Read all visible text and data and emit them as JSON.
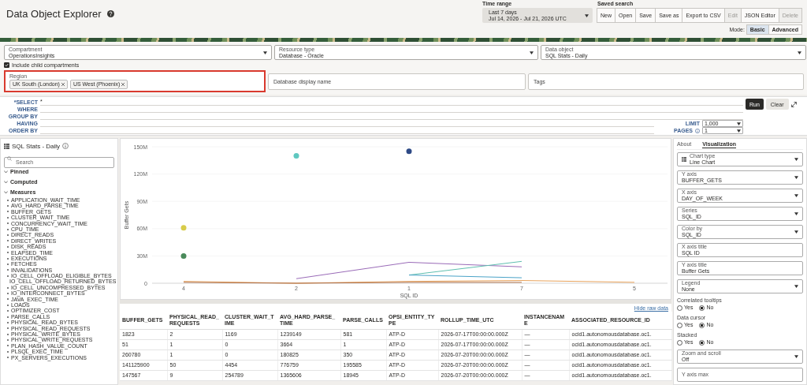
{
  "page": {
    "title": "Data Object Explorer"
  },
  "time_range": {
    "label": "Time range",
    "value": "Last 7 days",
    "subtext": "Jul 14, 2026 - Jul 21, 2026 UTC"
  },
  "saved_search": {
    "label": "Saved search",
    "buttons": [
      {
        "label": "New",
        "disabled": false
      },
      {
        "label": "Open",
        "disabled": false
      },
      {
        "label": "Save",
        "disabled": false
      },
      {
        "label": "Save as",
        "disabled": false
      },
      {
        "label": "Export to CSV",
        "disabled": false
      },
      {
        "label": "Edit",
        "disabled": true
      },
      {
        "label": "JSON Editor",
        "disabled": false
      },
      {
        "label": "Delete",
        "disabled": true
      }
    ]
  },
  "mode": {
    "label": "Mode:",
    "options": [
      {
        "label": "Basic",
        "selected": true
      },
      {
        "label": "Advanced",
        "selected": false
      }
    ]
  },
  "filters": {
    "selects": [
      {
        "label": "Compartment",
        "value": "OperationsInsights"
      },
      {
        "label": "Resource type",
        "value": "Database - Oracle"
      },
      {
        "label": "Data object",
        "value": "SQL Stats - Daily"
      }
    ],
    "include_child": {
      "label": "Include child compartments",
      "checked": true
    },
    "region": {
      "label": "Region",
      "highlighted": true,
      "chips": [
        "UK South (London)",
        "US West (Phoenix)"
      ]
    },
    "fields": [
      {
        "label": "Database display name"
      },
      {
        "label": "Tags"
      }
    ]
  },
  "query": {
    "clauses": [
      {
        "label": "*SELECT",
        "value": "*"
      },
      {
        "label": "WHERE"
      },
      {
        "label": "GROUP BY"
      },
      {
        "label": "HAVING"
      },
      {
        "label": "ORDER BY"
      }
    ],
    "limit": {
      "label": "LIMIT",
      "value": "1,000"
    },
    "pages": {
      "label": "PAGES",
      "value": "1"
    },
    "run": "Run",
    "clear": "Clear"
  },
  "sidebar": {
    "title": "SQL Stats - Daily",
    "search": {
      "placeholder": "Search"
    },
    "sections": [
      {
        "label": "Pinned",
        "expanded": true
      },
      {
        "label": "Computed",
        "expanded": true
      },
      {
        "label": "Measures",
        "expanded": true,
        "items": [
          "APPLICATION_WAIT_TIME",
          "AVG_HARD_PARSE_TIME",
          "BUFFER_GETS",
          "CLUSTER_WAIT_TIME",
          "CONCURRENCY_WAIT_TIME",
          "CPU_TIME",
          "DIRECT_READS",
          "DIRECT_WRITES",
          "DISK_READS",
          "ELAPSED_TIME",
          "EXECUTIONS",
          "FETCHES",
          "INVALIDATIONS",
          "IO_CELL_OFFLOAD_ELIGIBLE_BYTES",
          "IO_CELL_OFFLOAD_RETURNED_BYTES",
          "IO_CELL_UNCOMPRESSED_BYTES",
          "IO_INTERCONNECT_BYTES",
          "JAVA_EXEC_TIME",
          "LOADS",
          "OPTIMIZER_COST",
          "PARSE_CALLS",
          "PHYSICAL_READ_BYTES",
          "PHYSICAL_READ_REQUESTS",
          "PHYSICAL_WRITE_BYTES",
          "PHYSICAL_WRITE_REQUESTS",
          "PLAN_HASH_VALUE_COUNT",
          "PLSQL_EXEC_TIME",
          "PX_SERVERS_EXECUTIONS"
        ]
      }
    ]
  },
  "chart": {
    "chart_data": {
      "type": "line",
      "grid": true,
      "xlabel": "SQL ID",
      "ylabel": "Buffer Gets",
      "categories": [
        "4",
        "2",
        "1",
        "7",
        "5"
      ],
      "ylim": [
        0,
        150000000
      ],
      "yticks": [
        {
          "value": 0,
          "label": "0"
        },
        {
          "value": 30000000,
          "label": "30M"
        },
        {
          "value": 60000000,
          "label": "60M"
        },
        {
          "value": 90000000,
          "label": "90M"
        },
        {
          "value": 120000000,
          "label": "120M"
        },
        {
          "value": 150000000,
          "label": "150M"
        }
      ],
      "series": [
        {
          "color": "#9a6bb8",
          "values": [
            null,
            5000000,
            23000000,
            18000000,
            null
          ]
        },
        {
          "color": "#5fbfb0",
          "values": [
            null,
            null,
            9000000,
            24000000,
            null
          ]
        },
        {
          "color": "#4aa3c8",
          "values": [
            null,
            null,
            9000000,
            6000000,
            null
          ]
        },
        {
          "color": "#e8a25a",
          "values": [
            2000000,
            0,
            2000000,
            3000000,
            1000000
          ]
        },
        {
          "color": "#b0714a",
          "values": [
            1000000,
            0,
            1000000,
            1000000,
            null
          ]
        },
        {
          "color": "#5fc8c0",
          "marker": true,
          "values": [
            null,
            140000000,
            null,
            null,
            null
          ]
        },
        {
          "color": "#2e4a86",
          "marker": true,
          "values": [
            null,
            null,
            145000000,
            null,
            null
          ]
        },
        {
          "color": "#d8cc4a",
          "marker": true,
          "values": [
            61000000,
            null,
            null,
            null,
            null
          ]
        },
        {
          "color": "#4a8a5a",
          "marker": true,
          "values": [
            30000000,
            null,
            null,
            null,
            null
          ]
        }
      ]
    }
  },
  "raw_data": {
    "toggle": "Hide raw data",
    "columns": [
      "BUFFER_GETS",
      "PHYSICAL_READ_REQUESTS",
      "CLUSTER_WAIT_TIME",
      "AVG_HARD_PARSE_TIME",
      "PARSE_CALLS",
      "OPSI_ENTITY_TYPE",
      "ROLLUP_TIME_UTC",
      "INSTANCENAME",
      "ASSOCIATED_RESOURCE_ID"
    ],
    "rows": [
      [
        "1823",
        "2",
        "1169",
        "1239149",
        "581",
        "ATP-D",
        "2026-07-17T00:00:00.000Z",
        "—",
        "ocid1.autonomousdatabase.oc1."
      ],
      [
        "51",
        "1",
        "0",
        "3664",
        "1",
        "ATP-D",
        "2026-07-17T00:00:00.000Z",
        "—",
        "ocid1.autonomousdatabase.oc1."
      ],
      [
        "260780",
        "1",
        "0",
        "180825",
        "350",
        "ATP-D",
        "2026-07-20T00:00:00.000Z",
        "—",
        "ocid1.autonomousdatabase.oc1."
      ],
      [
        "141125900",
        "50",
        "4454",
        "776759",
        "195585",
        "ATP-D",
        "2026-07-20T00:00:00.000Z",
        "—",
        "ocid1.autonomousdatabase.oc1."
      ],
      [
        "147567",
        "9",
        "254789",
        "1365606",
        "18945",
        "ATP-D",
        "2026-07-20T00:00:00.000Z",
        "—",
        "ocid1.autonomousdatabase.oc1."
      ]
    ]
  },
  "settings_panel": {
    "tabs": [
      {
        "label": "About",
        "selected": false
      },
      {
        "label": "Visualization",
        "selected": true
      }
    ],
    "items": [
      {
        "kind": "select",
        "label": "Chart type",
        "value": "Line Chart",
        "icon": true
      },
      {
        "kind": "select",
        "label": "Y axis",
        "value": "BUFFER_GETS"
      },
      {
        "kind": "select",
        "label": "X axis",
        "value": "DAY_OF_WEEK"
      },
      {
        "kind": "select",
        "label": "Series",
        "value": "SQL_ID"
      },
      {
        "kind": "select",
        "label": "Color by",
        "value": "SQL_ID"
      },
      {
        "kind": "text",
        "label": "X axis title",
        "value": "SQL ID"
      },
      {
        "kind": "text",
        "label": "Y axis title",
        "value": "Buffer Gets"
      },
      {
        "kind": "select",
        "label": "Legend",
        "value": "None"
      },
      {
        "kind": "radio",
        "label": "Correlated tooltips",
        "options": [
          {
            "label": "Yes",
            "selected": false
          },
          {
            "label": "No",
            "selected": true
          }
        ]
      },
      {
        "kind": "radio",
        "label": "Data cursor",
        "options": [
          {
            "label": "Yes",
            "selected": false
          },
          {
            "label": "No",
            "selected": true
          }
        ]
      },
      {
        "kind": "radio",
        "label": "Stacked",
        "options": [
          {
            "label": "Yes",
            "selected": false
          },
          {
            "label": "No",
            "selected": true
          }
        ]
      },
      {
        "kind": "select",
        "label": "Zoom and scroll",
        "value": "Off"
      },
      {
        "kind": "text",
        "label": "Y axis max"
      }
    ]
  }
}
